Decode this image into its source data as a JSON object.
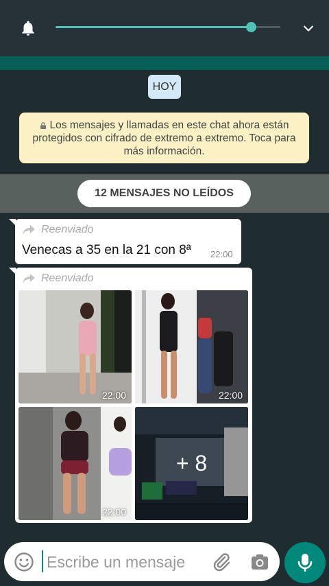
{
  "notification": {
    "volume_fraction": 0.87
  },
  "chat": {
    "date_label": "HOY",
    "encryption_notice": "Los mensajes y llamadas en este chat ahora están protegidos con cifrado de extremo a extremo. Toca para más información.",
    "unread_label": "12 MENSAJES NO LEÍDOS"
  },
  "messages": [
    {
      "forwarded_label": "Reenviado",
      "text": "Venecas a 35 en la 21 con 8ª",
      "time": "22:00"
    },
    {
      "forwarded_label": "Reenviado",
      "photos": [
        {
          "time": "22:00"
        },
        {
          "time": "22:00"
        },
        {
          "time": "22:00"
        },
        {
          "more_label": "+ 8"
        }
      ]
    }
  ],
  "composer": {
    "placeholder": "Escribe un mensaje"
  },
  "colors": {
    "accent": "#00897b",
    "slider": "#4fc3b5",
    "header": "#263238",
    "encryption_bg": "#fbf1c5"
  }
}
